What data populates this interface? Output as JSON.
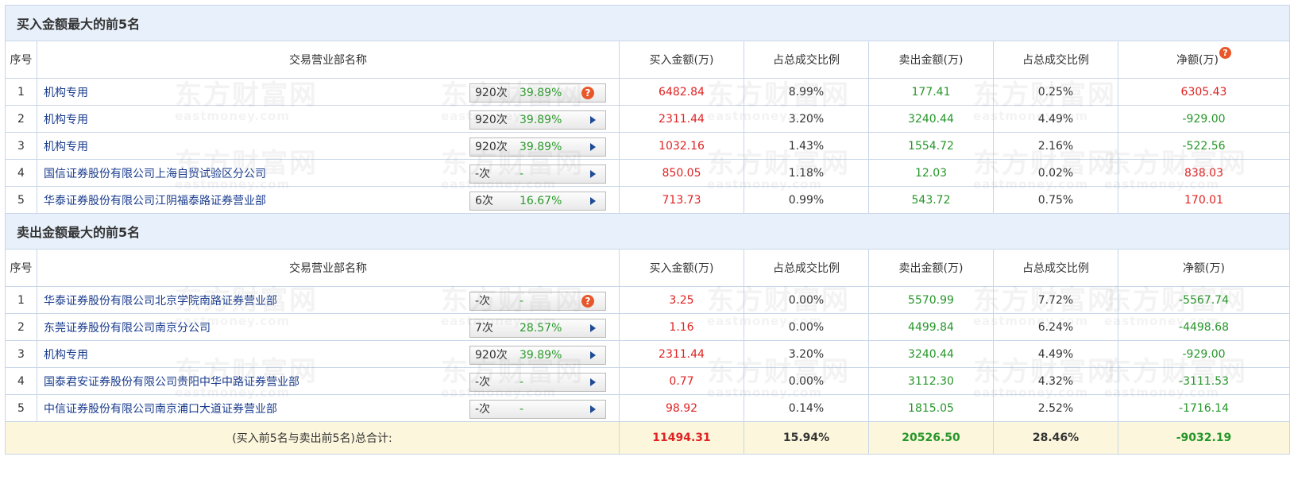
{
  "buy_section": {
    "title": "买入金额最大的前5名",
    "headers": [
      "序号",
      "交易营业部名称",
      "买入金额(万)",
      "占总成交比例",
      "卖出金额(万)",
      "占总成交比例",
      "净额(万)"
    ],
    "rows": [
      {
        "idx": "1",
        "name": "机构专用",
        "count": "920次",
        "pct": "39.89%",
        "icon": "help",
        "buy": "6482.84",
        "buy_ratio": "8.99%",
        "sell": "177.41",
        "sell_ratio": "0.25%",
        "net": "6305.43",
        "net_color": "red"
      },
      {
        "idx": "2",
        "name": "机构专用",
        "count": "920次",
        "pct": "39.89%",
        "icon": "arrow",
        "buy": "2311.44",
        "buy_ratio": "3.20%",
        "sell": "3240.44",
        "sell_ratio": "4.49%",
        "net": "-929.00",
        "net_color": "green"
      },
      {
        "idx": "3",
        "name": "机构专用",
        "count": "920次",
        "pct": "39.89%",
        "icon": "arrow",
        "buy": "1032.16",
        "buy_ratio": "1.43%",
        "sell": "1554.72",
        "sell_ratio": "2.16%",
        "net": "-522.56",
        "net_color": "green"
      },
      {
        "idx": "4",
        "name": "国信证券股份有限公司上海自贸试验区分公司",
        "count": "-次",
        "pct": "-",
        "icon": "arrow",
        "buy": "850.05",
        "buy_ratio": "1.18%",
        "sell": "12.03",
        "sell_ratio": "0.02%",
        "net": "838.03",
        "net_color": "red"
      },
      {
        "idx": "5",
        "name": "华泰证券股份有限公司江阴福泰路证券营业部",
        "count": "6次",
        "pct": "16.67%",
        "icon": "arrow",
        "buy": "713.73",
        "buy_ratio": "0.99%",
        "sell": "543.72",
        "sell_ratio": "0.75%",
        "net": "170.01",
        "net_color": "red"
      }
    ]
  },
  "sell_section": {
    "title": "卖出金额最大的前5名",
    "headers": [
      "序号",
      "交易营业部名称",
      "买入金额(万)",
      "占总成交比例",
      "卖出金额(万)",
      "占总成交比例",
      "净额(万)"
    ],
    "rows": [
      {
        "idx": "1",
        "name": "华泰证券股份有限公司北京学院南路证券营业部",
        "count": "-次",
        "pct": "-",
        "icon": "help",
        "buy": "3.25",
        "buy_ratio": "0.00%",
        "sell": "5570.99",
        "sell_ratio": "7.72%",
        "net": "-5567.74",
        "net_color": "green"
      },
      {
        "idx": "2",
        "name": "东莞证券股份有限公司南京分公司",
        "count": "7次",
        "pct": "28.57%",
        "icon": "arrow",
        "buy": "1.16",
        "buy_ratio": "0.00%",
        "sell": "4499.84",
        "sell_ratio": "6.24%",
        "net": "-4498.68",
        "net_color": "green"
      },
      {
        "idx": "3",
        "name": "机构专用",
        "count": "920次",
        "pct": "39.89%",
        "icon": "arrow",
        "buy": "2311.44",
        "buy_ratio": "3.20%",
        "sell": "3240.44",
        "sell_ratio": "4.49%",
        "net": "-929.00",
        "net_color": "green"
      },
      {
        "idx": "4",
        "name": "国泰君安证券股份有限公司贵阳中华中路证券营业部",
        "count": "-次",
        "pct": "-",
        "icon": "arrow",
        "buy": "0.77",
        "buy_ratio": "0.00%",
        "sell": "3112.30",
        "sell_ratio": "4.32%",
        "net": "-3111.53",
        "net_color": "green"
      },
      {
        "idx": "5",
        "name": "中信证券股份有限公司南京浦口大道证券营业部",
        "count": "-次",
        "pct": "-",
        "icon": "arrow",
        "buy": "98.92",
        "buy_ratio": "0.14%",
        "sell": "1815.05",
        "sell_ratio": "2.52%",
        "net": "-1716.14",
        "net_color": "green"
      }
    ]
  },
  "total": {
    "label": "(买入前5名与卖出前5名)总合计:",
    "buy": "11494.31",
    "buy_ratio": "15.94%",
    "sell": "20526.50",
    "sell_ratio": "28.46%",
    "net": "-9032.19"
  },
  "help_glyph": "?",
  "watermark": {
    "brand": "东方财富网",
    "domain": "eastmoney.com"
  },
  "colors": {
    "buy": "#e02222",
    "sell": "#26962a",
    "link": "#1a3c8e",
    "section_bg": "#e8f1fb",
    "total_bg": "#fcf7dc",
    "help_icon": "#e8572a",
    "arrow": "#1f4b96"
  }
}
